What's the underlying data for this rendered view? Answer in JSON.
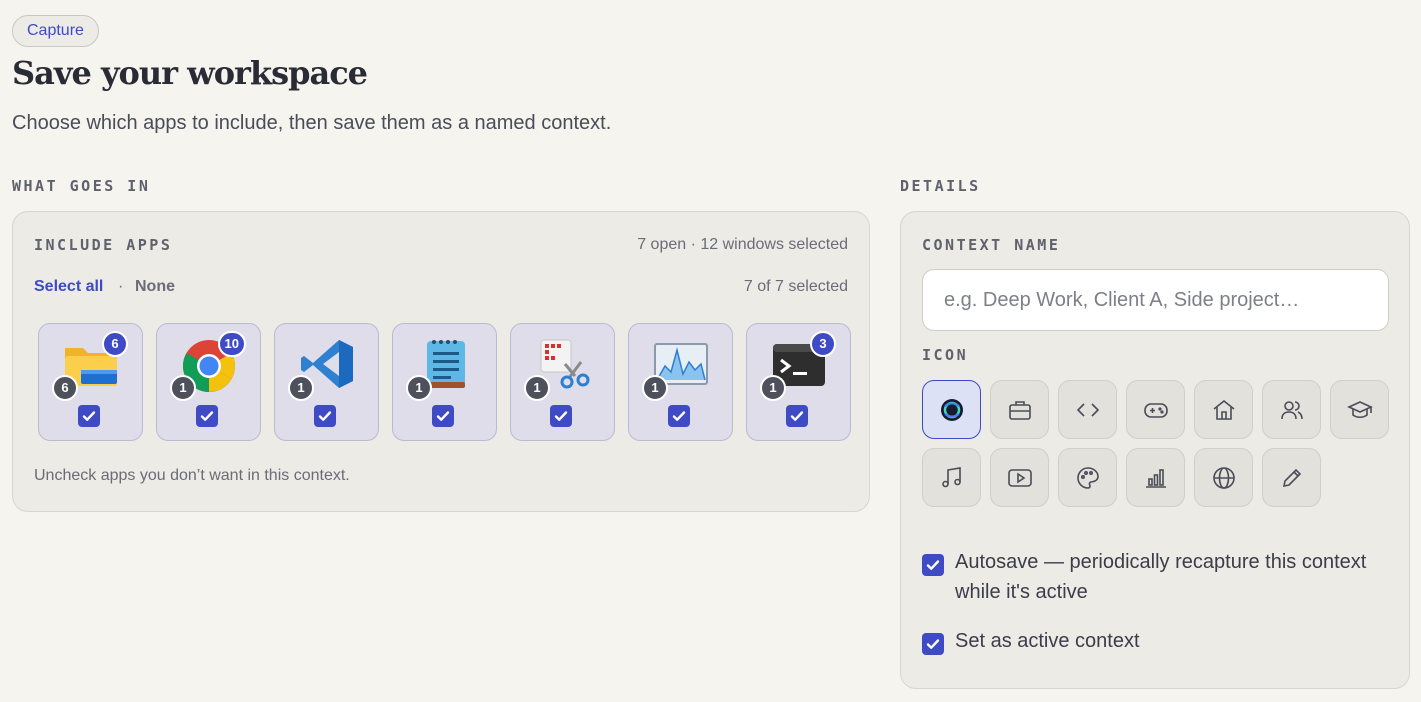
{
  "header": {
    "badge": "Capture",
    "title": "Save your workspace",
    "subtitle": "Choose which apps to include, then save them as a named context."
  },
  "sections": {
    "left_label": "WHAT GOES IN",
    "right_label": "DETAILS"
  },
  "include_apps": {
    "label": "INCLUDE APPS",
    "summary": "7 open · 12 windows selected",
    "select_all": "Select all",
    "separator": "·",
    "none": "None",
    "count": "7 of 7 selected",
    "hint": "Uncheck apps you don’t want in this context.",
    "apps": [
      {
        "icon": "file-explorer-icon",
        "top_badge": "6",
        "bottom_badge": "6",
        "checked": true
      },
      {
        "icon": "chrome-icon",
        "top_badge": "10",
        "bottom_badge": "1",
        "checked": true
      },
      {
        "icon": "vscode-icon",
        "top_badge": "",
        "bottom_badge": "1",
        "checked": true
      },
      {
        "icon": "notepad-icon",
        "top_badge": "",
        "bottom_badge": "1",
        "checked": true
      },
      {
        "icon": "snipping-tool-icon",
        "top_badge": "",
        "bottom_badge": "1",
        "checked": true
      },
      {
        "icon": "task-manager-icon",
        "top_badge": "",
        "bottom_badge": "1",
        "checked": true
      },
      {
        "icon": "terminal-icon",
        "top_badge": "3",
        "bottom_badge": "1",
        "checked": true
      }
    ]
  },
  "details": {
    "context_name_label": "CONTEXT NAME",
    "context_name_placeholder": "e.g. Deep Work, Client A, Side project…",
    "context_name_value": "",
    "icon_label": "ICON",
    "icons": [
      "app-logo-icon",
      "briefcase-icon",
      "code-icon",
      "gamepad-icon",
      "home-icon",
      "users-icon",
      "graduation-cap-icon",
      "music-icon",
      "play-icon",
      "palette-icon",
      "bar-chart-icon",
      "globe-icon",
      "pencil-icon"
    ],
    "selected_icon": "app-logo-icon",
    "autosave_label": "Autosave — periodically recapture this context while it's active",
    "autosave_checked": true,
    "set_active_label": "Set as active context",
    "set_active_checked": true
  },
  "colors": {
    "accent": "#3f4bc4",
    "background": "#f5f4ef",
    "card": "#ecebe6"
  }
}
